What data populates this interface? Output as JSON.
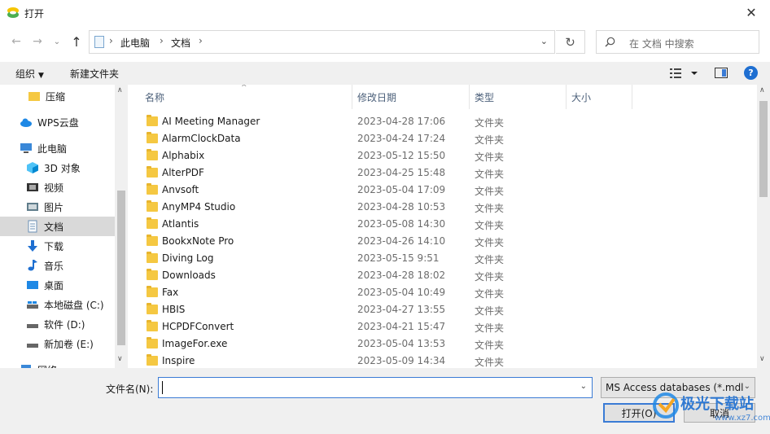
{
  "window": {
    "title": "打开",
    "close_glyph": "✕"
  },
  "nav_buttons": {
    "back": "←",
    "forward": "→",
    "dropdown": "⌄",
    "up": "↑"
  },
  "address": {
    "crumbs": [
      "此电脑",
      "文档"
    ],
    "separator": "›",
    "dropdown_glyph": "⌄",
    "refresh_glyph": "↻"
  },
  "search": {
    "placeholder": "在 文档 中搜索"
  },
  "toolbar": {
    "organize_label": "组织",
    "organize_arrow": "▼",
    "new_folder_label": "新建文件夹",
    "help_label": "?"
  },
  "nav_pane": {
    "items": [
      {
        "label": "压缩",
        "icon": "folder-icon"
      },
      {
        "label": "WPS云盘",
        "icon": "cloud-icon"
      },
      {
        "label": "此电脑",
        "icon": "computer-icon"
      },
      {
        "label": "3D 对象",
        "icon": "cube-icon"
      },
      {
        "label": "视频",
        "icon": "video-icon"
      },
      {
        "label": "图片",
        "icon": "picture-icon"
      },
      {
        "label": "文档",
        "icon": "document-icon",
        "selected": true
      },
      {
        "label": "下载",
        "icon": "download-icon"
      },
      {
        "label": "音乐",
        "icon": "music-icon"
      },
      {
        "label": "桌面",
        "icon": "desktop-icon"
      },
      {
        "label": "本地磁盘 (C:)",
        "icon": "drive-icon"
      },
      {
        "label": "软件 (D:)",
        "icon": "drive-icon"
      },
      {
        "label": "新加卷 (E:)",
        "icon": "drive-icon"
      },
      {
        "label": "网络",
        "icon": "network-icon"
      }
    ],
    "scroll_up": "∧",
    "scroll_down": "∨"
  },
  "file_list": {
    "columns": {
      "name": "名称",
      "modified": "修改日期",
      "type": "类型",
      "size": "大小"
    },
    "sort_glyph": "^",
    "rows": [
      {
        "name": "AI Meeting Manager",
        "modified": "2023-04-28 17:06",
        "type": "文件夹"
      },
      {
        "name": "AlarmClockData",
        "modified": "2023-04-24 17:24",
        "type": "文件夹"
      },
      {
        "name": "Alphabix",
        "modified": "2023-05-12 15:50",
        "type": "文件夹"
      },
      {
        "name": "AlterPDF",
        "modified": "2023-04-25 15:48",
        "type": "文件夹"
      },
      {
        "name": "Anvsoft",
        "modified": "2023-05-04 17:09",
        "type": "文件夹"
      },
      {
        "name": "AnyMP4 Studio",
        "modified": "2023-04-28 10:53",
        "type": "文件夹"
      },
      {
        "name": "Atlantis",
        "modified": "2023-05-08 14:30",
        "type": "文件夹"
      },
      {
        "name": "BookxNote Pro",
        "modified": "2023-04-26 14:10",
        "type": "文件夹"
      },
      {
        "name": "Diving Log",
        "modified": "2023-05-15 9:51",
        "type": "文件夹"
      },
      {
        "name": "Downloads",
        "modified": "2023-04-28 18:02",
        "type": "文件夹"
      },
      {
        "name": "Fax",
        "modified": "2023-05-04 10:49",
        "type": "文件夹"
      },
      {
        "name": "HBIS",
        "modified": "2023-04-27 13:55",
        "type": "文件夹"
      },
      {
        "name": "HCPDFConvert",
        "modified": "2023-04-21 15:47",
        "type": "文件夹"
      },
      {
        "name": "ImageFor.exe",
        "modified": "2023-05-04 13:53",
        "type": "文件夹"
      },
      {
        "name": "Inspire",
        "modified": "2023-05-09 14:34",
        "type": "文件夹"
      }
    ],
    "scroll_up": "∧",
    "scroll_down": "∨"
  },
  "bottom": {
    "filename_label": "文件名(N):",
    "filename_value": "",
    "filename_dropdown": "⌄",
    "filetype_value": "MS Access databases (*.mdl",
    "filetype_dropdown": "⌄",
    "open_label": "打开(O)",
    "cancel_label": "取消"
  },
  "watermark": {
    "text": "极光下载站",
    "url_text": "www.xz7.com"
  }
}
